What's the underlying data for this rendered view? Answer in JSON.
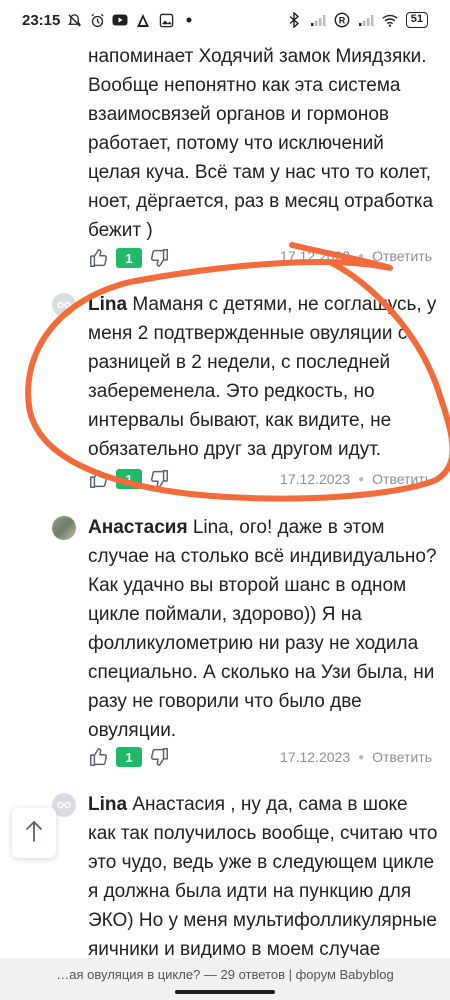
{
  "status_bar": {
    "time": "23:15",
    "battery": "51"
  },
  "comments": [
    {
      "text": "напоминает Ходячий замок Миядзяки. Вообще непонятно как эта система взаимосвязей органов и гормонов работает, потому что исключений целая куча. Всё там у нас что то колет, ноет, дёргается, раз в месяц отработка бежит )",
      "likes": "1",
      "date": "17.12.2023",
      "reply_label": "Ответить"
    },
    {
      "author": "Lina",
      "text": " Маманя с детями, не соглашусь, у меня 2 подтвержденные овуляции с разницей в 2 недели, с последней забеременела. Это редкость, но интервалы бывают, как видите, не обязательно друг за другом идут.",
      "likes": "1",
      "date": "17.12.2023",
      "reply_label": "Ответить"
    },
    {
      "author": "Анастасия",
      "text": " Lina, ого! даже в этом случае на столько всё индивидуально? Как удачно вы второй шанс в одном цикле поймали, здорово)) Я на фолликулометрию ни разу не ходила специально. А сколько на Узи была, ни разу не говорили что было две овуляции.",
      "likes": "1",
      "date": "17.12.2023",
      "reply_label": "Ответить"
    },
    {
      "author": "Lina",
      "text": " Анастасия , ну да, сама в шоке как так получилось вообще, считаю что это чудо, ведь уже в следующем цикле я должна была идти на пункцию для ЭКО) Но у меня мультифолликулярные яичники и видимо в моем случае"
    }
  ],
  "bottom_bar": {
    "title": "…ая овуляция в цикле? — 29 ответов | форум Babyblog"
  },
  "colors": {
    "badge": "#1fb96a",
    "annotation": "#f26b3a",
    "meta": "#8a8f98"
  }
}
